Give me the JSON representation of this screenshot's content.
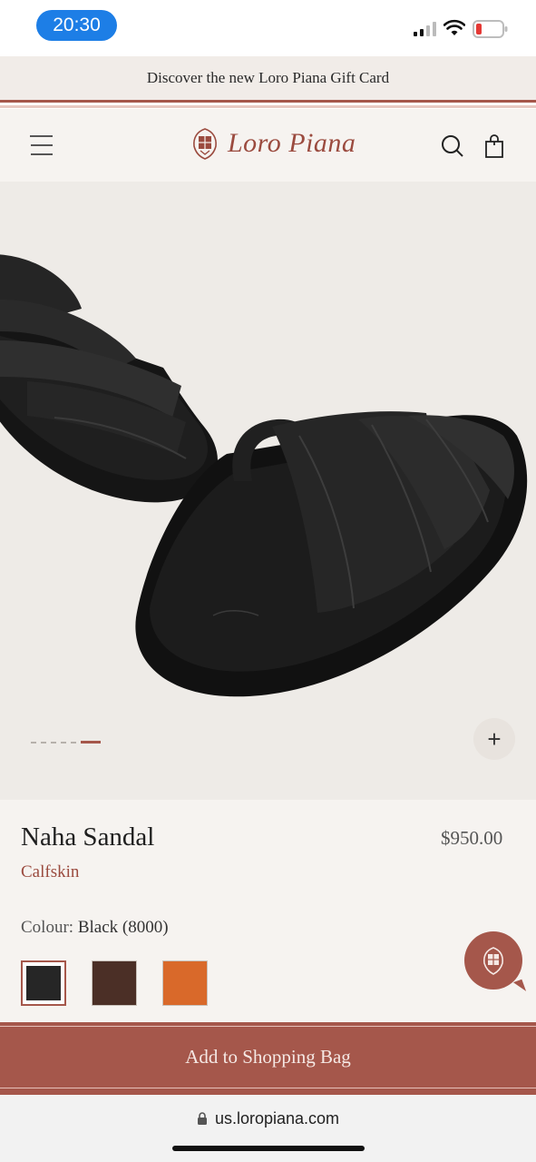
{
  "status_bar": {
    "time": "20:30",
    "signal_icon": "cellular-signal-icon",
    "wifi_icon": "wifi-icon",
    "battery_icon": "battery-low-icon"
  },
  "promo": {
    "text": "Discover the new Loro Piana Gift Card"
  },
  "header": {
    "brand": "Loro Piana",
    "menu_icon": "hamburger-menu-icon",
    "search_icon": "search-icon",
    "bag_icon": "shopping-bag-icon"
  },
  "gallery": {
    "slide_count": 6,
    "active_slide": 6,
    "zoom_label": "+"
  },
  "product": {
    "name": "Naha Sandal",
    "price": "$950.00",
    "material": "Calfskin",
    "colour_label": "Colour:",
    "colour_value": "Black (8000)",
    "swatches": [
      {
        "name": "Black",
        "color": "#262626",
        "selected": true
      },
      {
        "name": "Brown",
        "color": "#4b2f26",
        "selected": false
      },
      {
        "name": "Orange",
        "color": "#d9692a",
        "selected": false
      }
    ]
  },
  "cta": {
    "label": "Add to Shopping Bag"
  },
  "browser": {
    "url": "us.loropiana.com",
    "lock_icon": "lock-icon"
  },
  "colors": {
    "accent": "#a5574b",
    "promo_bg": "#f1ece8",
    "page_bg": "#f6f3f0",
    "time_pill": "#1d7ee6"
  }
}
